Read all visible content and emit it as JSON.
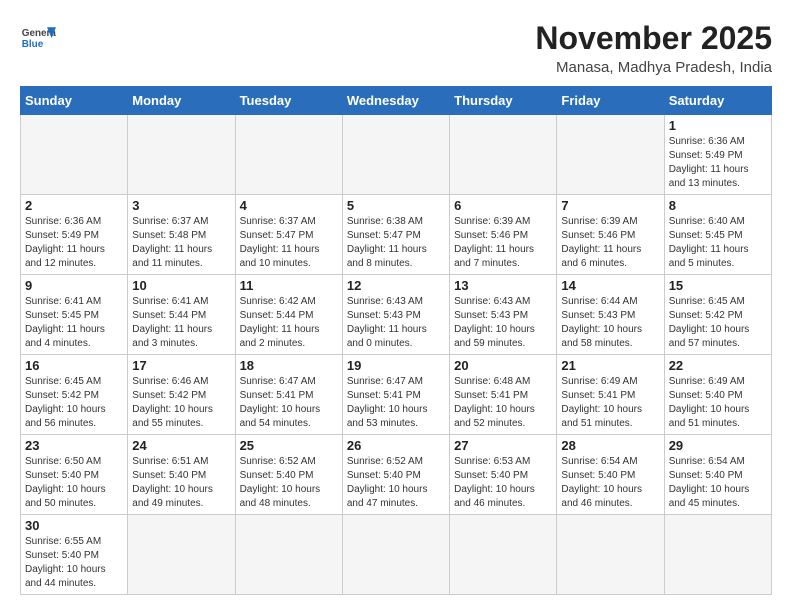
{
  "header": {
    "logo_general": "General",
    "logo_blue": "Blue",
    "month_title": "November 2025",
    "location": "Manasa, Madhya Pradesh, India"
  },
  "weekdays": [
    "Sunday",
    "Monday",
    "Tuesday",
    "Wednesday",
    "Thursday",
    "Friday",
    "Saturday"
  ],
  "weeks": [
    [
      {
        "day": "",
        "info": ""
      },
      {
        "day": "",
        "info": ""
      },
      {
        "day": "",
        "info": ""
      },
      {
        "day": "",
        "info": ""
      },
      {
        "day": "",
        "info": ""
      },
      {
        "day": "",
        "info": ""
      },
      {
        "day": "1",
        "info": "Sunrise: 6:36 AM\nSunset: 5:49 PM\nDaylight: 11 hours\nand 13 minutes."
      }
    ],
    [
      {
        "day": "2",
        "info": "Sunrise: 6:36 AM\nSunset: 5:49 PM\nDaylight: 11 hours\nand 12 minutes."
      },
      {
        "day": "3",
        "info": "Sunrise: 6:37 AM\nSunset: 5:48 PM\nDaylight: 11 hours\nand 11 minutes."
      },
      {
        "day": "4",
        "info": "Sunrise: 6:37 AM\nSunset: 5:47 PM\nDaylight: 11 hours\nand 10 minutes."
      },
      {
        "day": "5",
        "info": "Sunrise: 6:38 AM\nSunset: 5:47 PM\nDaylight: 11 hours\nand 8 minutes."
      },
      {
        "day": "6",
        "info": "Sunrise: 6:39 AM\nSunset: 5:46 PM\nDaylight: 11 hours\nand 7 minutes."
      },
      {
        "day": "7",
        "info": "Sunrise: 6:39 AM\nSunset: 5:46 PM\nDaylight: 11 hours\nand 6 minutes."
      },
      {
        "day": "8",
        "info": "Sunrise: 6:40 AM\nSunset: 5:45 PM\nDaylight: 11 hours\nand 5 minutes."
      }
    ],
    [
      {
        "day": "9",
        "info": "Sunrise: 6:41 AM\nSunset: 5:45 PM\nDaylight: 11 hours\nand 4 minutes."
      },
      {
        "day": "10",
        "info": "Sunrise: 6:41 AM\nSunset: 5:44 PM\nDaylight: 11 hours\nand 3 minutes."
      },
      {
        "day": "11",
        "info": "Sunrise: 6:42 AM\nSunset: 5:44 PM\nDaylight: 11 hours\nand 2 minutes."
      },
      {
        "day": "12",
        "info": "Sunrise: 6:43 AM\nSunset: 5:43 PM\nDaylight: 11 hours\nand 0 minutes."
      },
      {
        "day": "13",
        "info": "Sunrise: 6:43 AM\nSunset: 5:43 PM\nDaylight: 10 hours\nand 59 minutes."
      },
      {
        "day": "14",
        "info": "Sunrise: 6:44 AM\nSunset: 5:43 PM\nDaylight: 10 hours\nand 58 minutes."
      },
      {
        "day": "15",
        "info": "Sunrise: 6:45 AM\nSunset: 5:42 PM\nDaylight: 10 hours\nand 57 minutes."
      }
    ],
    [
      {
        "day": "16",
        "info": "Sunrise: 6:45 AM\nSunset: 5:42 PM\nDaylight: 10 hours\nand 56 minutes."
      },
      {
        "day": "17",
        "info": "Sunrise: 6:46 AM\nSunset: 5:42 PM\nDaylight: 10 hours\nand 55 minutes."
      },
      {
        "day": "18",
        "info": "Sunrise: 6:47 AM\nSunset: 5:41 PM\nDaylight: 10 hours\nand 54 minutes."
      },
      {
        "day": "19",
        "info": "Sunrise: 6:47 AM\nSunset: 5:41 PM\nDaylight: 10 hours\nand 53 minutes."
      },
      {
        "day": "20",
        "info": "Sunrise: 6:48 AM\nSunset: 5:41 PM\nDaylight: 10 hours\nand 52 minutes."
      },
      {
        "day": "21",
        "info": "Sunrise: 6:49 AM\nSunset: 5:41 PM\nDaylight: 10 hours\nand 51 minutes."
      },
      {
        "day": "22",
        "info": "Sunrise: 6:49 AM\nSunset: 5:40 PM\nDaylight: 10 hours\nand 51 minutes."
      }
    ],
    [
      {
        "day": "23",
        "info": "Sunrise: 6:50 AM\nSunset: 5:40 PM\nDaylight: 10 hours\nand 50 minutes."
      },
      {
        "day": "24",
        "info": "Sunrise: 6:51 AM\nSunset: 5:40 PM\nDaylight: 10 hours\nand 49 minutes."
      },
      {
        "day": "25",
        "info": "Sunrise: 6:52 AM\nSunset: 5:40 PM\nDaylight: 10 hours\nand 48 minutes."
      },
      {
        "day": "26",
        "info": "Sunrise: 6:52 AM\nSunset: 5:40 PM\nDaylight: 10 hours\nand 47 minutes."
      },
      {
        "day": "27",
        "info": "Sunrise: 6:53 AM\nSunset: 5:40 PM\nDaylight: 10 hours\nand 46 minutes."
      },
      {
        "day": "28",
        "info": "Sunrise: 6:54 AM\nSunset: 5:40 PM\nDaylight: 10 hours\nand 46 minutes."
      },
      {
        "day": "29",
        "info": "Sunrise: 6:54 AM\nSunset: 5:40 PM\nDaylight: 10 hours\nand 45 minutes."
      }
    ],
    [
      {
        "day": "30",
        "info": "Sunrise: 6:55 AM\nSunset: 5:40 PM\nDaylight: 10 hours\nand 44 minutes."
      },
      {
        "day": "",
        "info": ""
      },
      {
        "day": "",
        "info": ""
      },
      {
        "day": "",
        "info": ""
      },
      {
        "day": "",
        "info": ""
      },
      {
        "day": "",
        "info": ""
      },
      {
        "day": "",
        "info": ""
      }
    ]
  ]
}
